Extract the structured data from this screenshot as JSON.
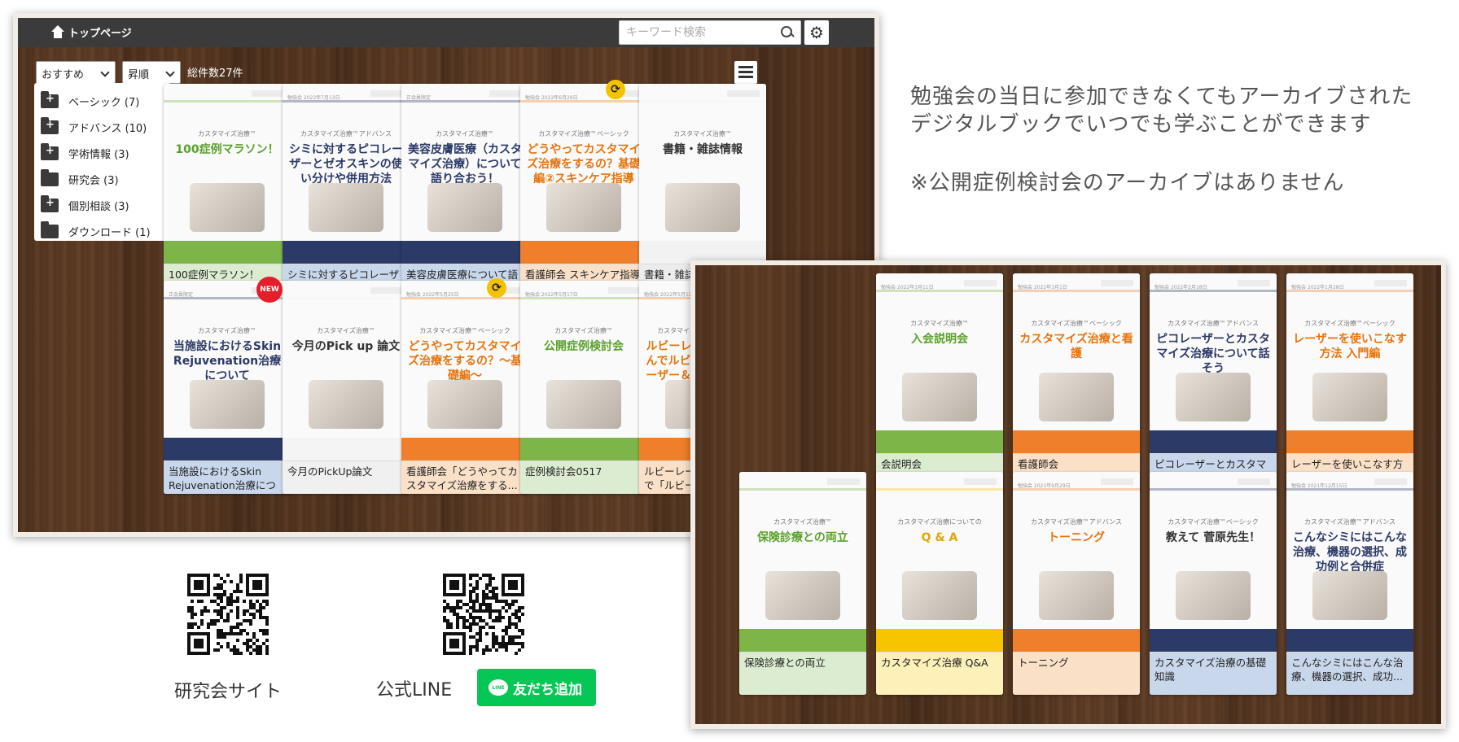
{
  "header": {
    "home_label": "トップページ",
    "search_placeholder": "キーワード検索"
  },
  "toolbar": {
    "sort_selected": "おすすめ",
    "order_selected": "昇順",
    "total_count": "総件数27件"
  },
  "sidebar": {
    "items": [
      {
        "label": "ベーシック (7)",
        "icon": "folder-plus-icon"
      },
      {
        "label": "アドバンス (10)",
        "icon": "folder-plus-icon"
      },
      {
        "label": "学術情報 (3)",
        "icon": "folder-plus-icon"
      },
      {
        "label": "研究会 (3)",
        "icon": "folder-icon"
      },
      {
        "label": "個別相談 (3)",
        "icon": "folder-plus-icon"
      },
      {
        "label": "ダウンロード (1)",
        "icon": "folder-icon"
      }
    ]
  },
  "left_cards": [
    {
      "title": "100症例マラソン！",
      "tag": "",
      "series": "カスタマイズ治療™",
      "cover": "100症例マラソン！",
      "title_bg": "#dcecd0",
      "strip": "#7db548",
      "cover_color": "#5aa02c"
    },
    {
      "title": "シミに対するピコレーザーとゼオスキンの使い...",
      "tag": "勉強会 2022年7月13日",
      "series": "カスタマイズ治療™アドバンス",
      "cover": "シミに対するピコレーザーとゼオスキンの使い分けや併用方法",
      "title_bg": "#c9d7ec",
      "strip": "#2b3a67",
      "cover_color": "#2b3a67"
    },
    {
      "title": "美容皮膚医療について語り合おう！",
      "tag": "正会員限定",
      "series": "カスタマイズ治療™",
      "cover": "美容皮膚医療（カスタマイズ治療）について語り合おう！",
      "title_bg": "#c9d7ec",
      "strip": "#2b3a67",
      "cover_color": "#2b3a67"
    },
    {
      "title": "看護師会 スキンケア指導",
      "tag": "勉強会 2022年6月29日",
      "series": "カスタマイズ治療™ベーシック",
      "cover": "どうやってカスタマイズ治療をするの？基礎編②スキンケア指導",
      "title_bg": "#fbe0c8",
      "strip": "#ef7f2a",
      "cover_color": "#e8730c"
    },
    {
      "title": "書籍・雑誌情報",
      "tag": "",
      "series": "カスタマイズ治療™",
      "cover": "書籍・雑誌情報",
      "title_bg": "#ececec",
      "strip": "#f2f2f2",
      "cover_color": "#333333"
    },
    {
      "title": "当施設におけるSkin Rejuvenation治療について",
      "tag": "正会員限定",
      "series": "カスタマイズ治療™",
      "cover": "当施設におけるSkin Rejuvenation治療について",
      "title_bg": "#c9d7ec",
      "strip": "#2b3a67",
      "cover_color": "#2b3a67"
    },
    {
      "title": "今月のPickUp論文",
      "tag": "",
      "series": "カスタマイズ治療™",
      "cover": "今月のPick up 論文",
      "title_bg": "#f0f0f0",
      "strip": "#f4f4f4",
      "cover_color": "#333333"
    },
    {
      "title": "看護師会「どうやってカスタマイズ治療をする...",
      "tag": "勉強会 2022年5月25日",
      "series": "カスタマイズ治療™ベーシック",
      "cover": "どうやってカスタマイズ治療をするの？〜基礎編〜",
      "title_bg": "#fbe0c8",
      "strip": "#ef7f2a",
      "cover_color": "#e8730c"
    },
    {
      "title": "症例検討会0517",
      "tag": "勉強会 2022年5月17日",
      "series": "カスタマイズ治療™",
      "cover": "公開症例検討会",
      "title_bg": "#dcecd0",
      "strip": "#7db548",
      "cover_color": "#5aa02c"
    },
    {
      "title": "ルビーレーザーってなんで「ルビー」なの？",
      "tag": "勉強会 2022年5月12日",
      "series": "カスタマイズ治療™ベーシック",
      "cover": "ルビーレーザーってなんでルビーなの？〜レーザー＆カスタマイズ治療入門〜",
      "title_bg": "#fbe0c8",
      "strip": "#ef7f2a",
      "cover_color": "#e8730c"
    }
  ],
  "badges": {
    "new": "NEW",
    "sync": "⟳"
  },
  "right_cards": [
    {
      "title": "会説明会",
      "tag": "勉強会 2022年3月11日",
      "series": "カスタマイズ治療™",
      "cover": "入会説明会",
      "title_bg": "#dcecd0",
      "strip": "#7db548",
      "cover_color": "#5aa02c"
    },
    {
      "title": "看護師会",
      "tag": "勉強会 2022年3月1日",
      "series": "カスタマイズ治療™ベーシック",
      "cover": "カスタマイズ治療と看護",
      "title_bg": "#fbe0c8",
      "strip": "#ef7f2a",
      "cover_color": "#e8730c"
    },
    {
      "title": "ピコレーザーとカスタマイズ治療について話そう",
      "tag": "勉強会 2022年2月18日",
      "series": "カスタマイズ治療™アドバンス",
      "cover": "ピコレーザーとカスタマイズ治療について話そう",
      "title_bg": "#c9d7ec",
      "strip": "#2b3a67",
      "cover_color": "#2b3a67"
    },
    {
      "title": "レーザーを使いこなす方法-入門編",
      "tag": "勉強会 2022年1月28日",
      "series": "カスタマイズ治療™ベーシック",
      "cover": "レーザーを使いこなす方法 入門編",
      "title_bg": "#fbe0c8",
      "strip": "#ef7f2a",
      "cover_color": "#e8730c"
    },
    {
      "title": "保険診療との両立",
      "tag": "",
      "series": "カスタマイズ治療™",
      "cover": "保険診療との両立",
      "title_bg": "#dcecd0",
      "strip": "#7db548",
      "cover_color": "#5aa02c"
    },
    {
      "title": "カスタマイズ治療 Q&A",
      "tag": "",
      "series": "カスタマイズ治療についての",
      "cover": "Q & A",
      "title_bg": "#fdf0b8",
      "strip": "#f6c500",
      "cover_color": "#e0a800"
    },
    {
      "title": "トーニング",
      "tag": "勉強会 2021年9月29日",
      "series": "カスタマイズ治療™アドバンス",
      "cover": "トーニング",
      "title_bg": "#fbe0c8",
      "strip": "#ef7f2a",
      "cover_color": "#e8730c"
    },
    {
      "title": "カスタマイズ治療の基礎知識",
      "tag": "",
      "series": "カスタマイズ治療™ベーシック",
      "cover": "教えて 菅原先生！",
      "title_bg": "#c9d7ec",
      "strip": "#2b3a67",
      "cover_color": "#333333"
    },
    {
      "title": "こんなシミにはこんな治療、機器の選択、成功...",
      "tag": "勉強会 2021年12月15日",
      "series": "カスタマイズ治療™アドバンス",
      "cover": "こんなシミにはこんな治療、機器の選択、成功例と合併症",
      "title_bg": "#c9d7ec",
      "strip": "#2b3a67",
      "cover_color": "#2b3a67"
    }
  ],
  "caption": {
    "line1": "勉強会の当日に参加できなくてもアーカイブされた",
    "line2": "デジタルブックでいつでも学ぶことができます",
    "note": "※公開症例検討会のアーカイブはありません"
  },
  "links": {
    "site_label": "研究会サイト",
    "line_label": "公式LINE",
    "line_button": "友だち追加",
    "line_logo": "LINE"
  }
}
